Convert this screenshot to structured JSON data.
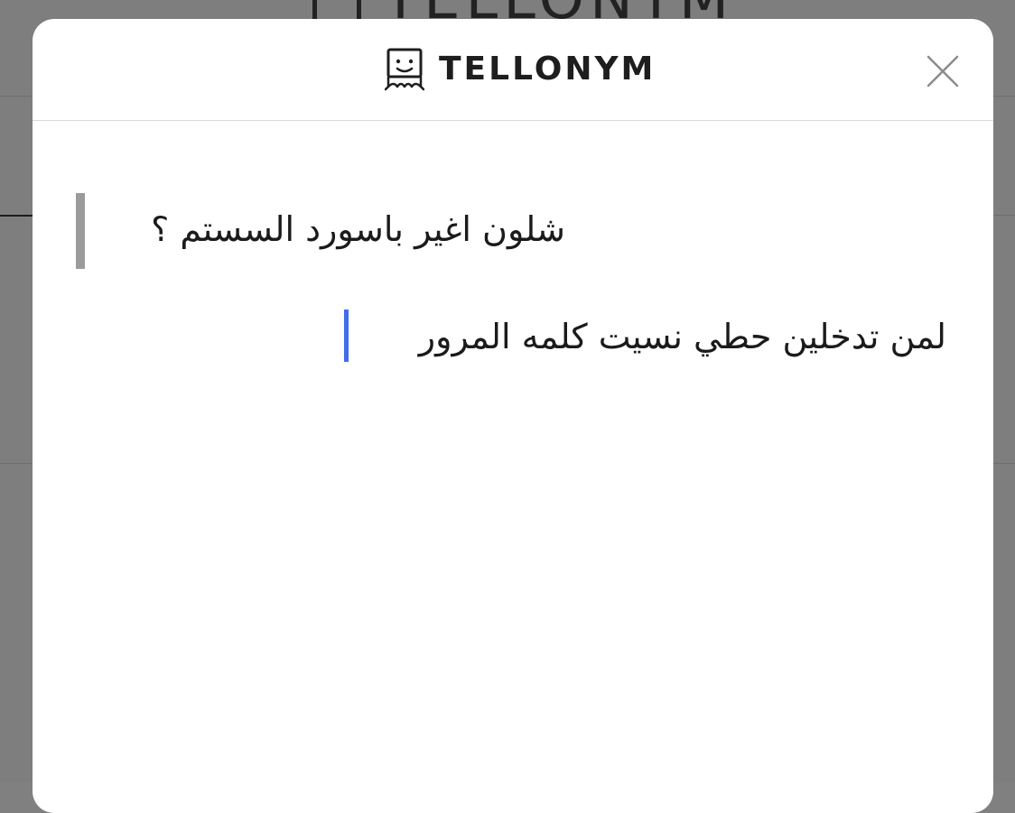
{
  "background": {
    "logo_text": "TELLONYM"
  },
  "modal": {
    "brand_name": "TELLONYM",
    "brand_icon": "tellonym-face-icon",
    "close_icon": "close-icon"
  },
  "question": {
    "text": "شلون اغير باسورد السستم ؟"
  },
  "answer": {
    "text": "لمن تدخلين حطي نسيت كلمه المرور"
  },
  "colors": {
    "overlay": "#7e7e7e",
    "modal_bg": "#ffffff",
    "quote_bar": "#9b9b9b",
    "caret": "#3f6ee8",
    "text": "#1b1b1b"
  }
}
